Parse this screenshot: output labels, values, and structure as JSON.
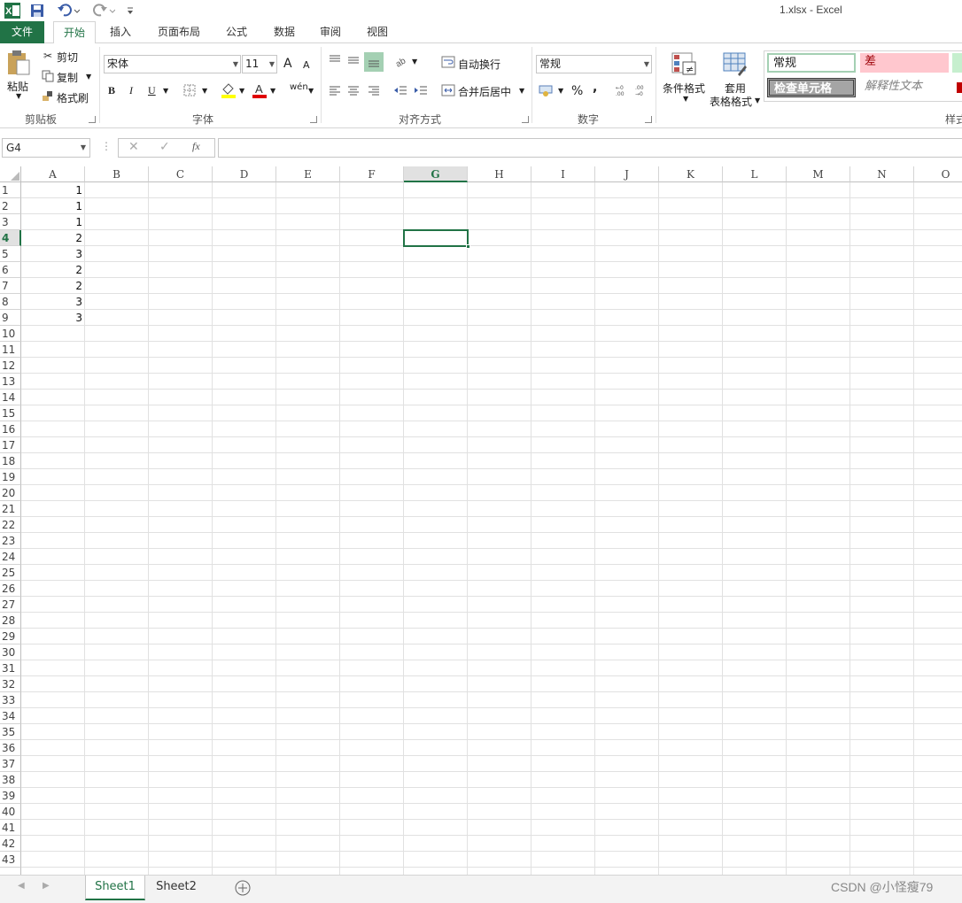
{
  "window": {
    "title": "1.xlsx - Excel"
  },
  "tabs": [
    "文件",
    "开始",
    "插入",
    "页面布局",
    "公式",
    "数据",
    "审阅",
    "视图"
  ],
  "ribbon": {
    "clipboard": {
      "paste": "粘贴",
      "cut": "剪切",
      "copy": "复制",
      "format_painter": "格式刷",
      "label": "剪贴板"
    },
    "font": {
      "name": "宋体",
      "size": "11",
      "bold": "B",
      "italic": "I",
      "underline": "U",
      "grow": "A",
      "shrink": "A",
      "label": "字体",
      "phonetic": "wén"
    },
    "alignment": {
      "wrap": "自动换行",
      "merge": "合并后居中",
      "label": "对齐方式"
    },
    "number": {
      "format": "常规",
      "percent": "%",
      "comma": ",",
      "label": "数字"
    },
    "styles": {
      "conditional": "条件格式",
      "table_1": "套用",
      "table_2": "表格格式",
      "normal": "常规",
      "bad": "差",
      "check": "检查单元格",
      "explanatory": "解释性文本",
      "label": "样式"
    }
  },
  "formula_bar": {
    "name_box": "G4",
    "fx": "fx",
    "value": ""
  },
  "grid": {
    "columns": [
      "A",
      "B",
      "C",
      "D",
      "E",
      "F",
      "G",
      "H",
      "I",
      "J",
      "K",
      "L",
      "M",
      "N",
      "O"
    ],
    "selected_column": "G",
    "selected_row": 4,
    "row_count": 43,
    "data": {
      "A": [
        1,
        1,
        1,
        2,
        3,
        2,
        2,
        3,
        3
      ]
    }
  },
  "sheets": [
    "Sheet1",
    "Sheet2"
  ],
  "active_sheet": "Sheet1",
  "watermark": "CSDN @小怪瘦79",
  "colors": {
    "accent": "#217346",
    "bad_fill": "#ffc7ce",
    "bad_text": "#9c0006",
    "check_fill": "#a5a5a5"
  }
}
